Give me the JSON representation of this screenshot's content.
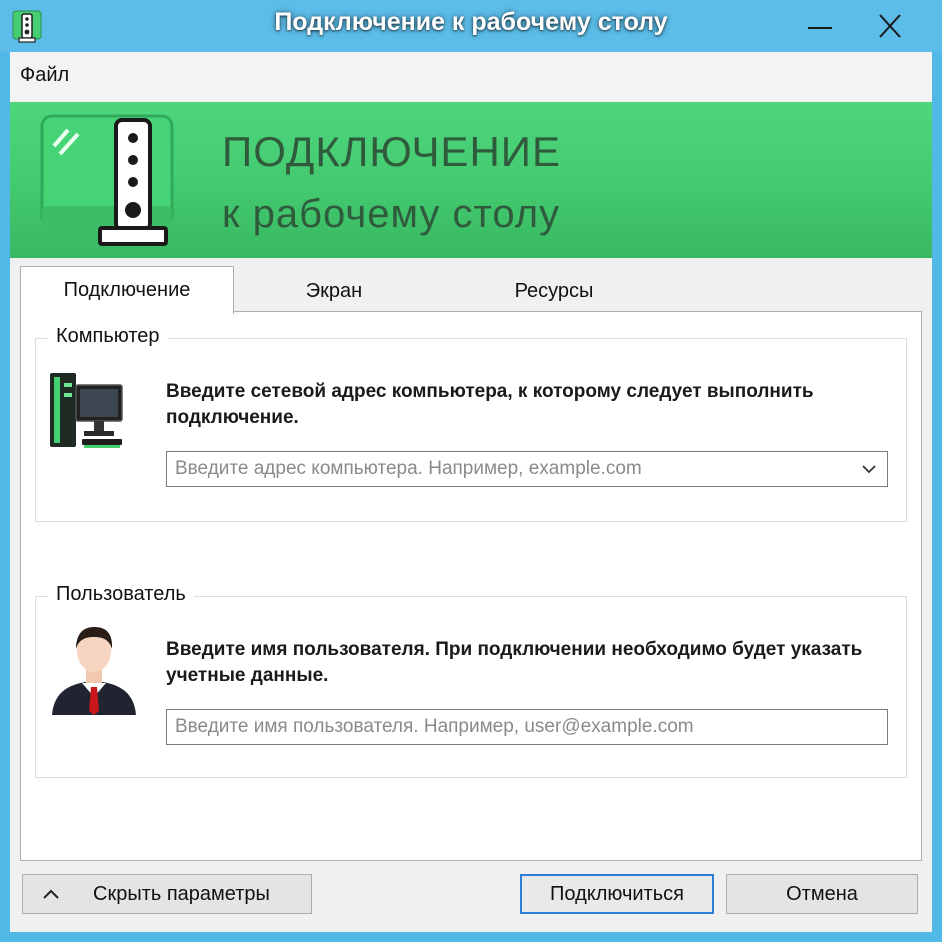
{
  "window": {
    "title": "Подключение к рабочему столу"
  },
  "menu": {
    "items": [
      {
        "label": "Файл"
      }
    ]
  },
  "banner": {
    "line1": "ПОДКЛЮЧЕНИЕ",
    "line2": "к рабочему столу"
  },
  "tabs": [
    {
      "label": "Подключение",
      "active": true
    },
    {
      "label": "Экран",
      "active": false
    },
    {
      "label": "Ресурсы",
      "active": false
    }
  ],
  "computer_group": {
    "label": "Компьютер",
    "description": "Введите сетевой адрес компьютера, к которому следует выполнить подключение.",
    "input_placeholder": "Введите адрес компьютера. Например, example.com",
    "icon": "computer-icon"
  },
  "user_group": {
    "label": "Пользователь",
    "description": "Введите имя пользователя. При подключении необходимо будет указать учетные данные.",
    "input_placeholder": "Введите имя пользователя. Например, user@example.com",
    "icon": "user-icon"
  },
  "buttons": {
    "toggle_options": "Скрыть параметры",
    "connect": "Подключиться",
    "cancel": "Отмена"
  },
  "colors": {
    "title_bar": "#5cbde9",
    "banner_green": "#43c96f",
    "banner_text": "#2f5b3c",
    "primary_button_border": "#2f7fd6"
  }
}
